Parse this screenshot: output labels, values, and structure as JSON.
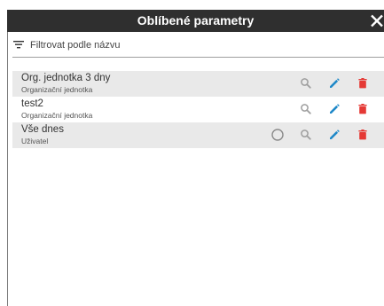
{
  "dialog": {
    "title": "Oblíbené parametry",
    "close_icon": "close-icon"
  },
  "filter": {
    "icon": "filter-list-icon",
    "placeholder": "Filtrovat podle názvu",
    "value": ""
  },
  "items": [
    {
      "title": "Org. jednotka 3 dny",
      "subtitle": "Organizační jednotka",
      "has_radio": false
    },
    {
      "title": "test2",
      "subtitle": "Organizační jednotka",
      "has_radio": false
    },
    {
      "title": "Vše dnes",
      "subtitle": "Uživatel",
      "has_radio": true
    }
  ],
  "colors": {
    "titlebar": "#2f2f2f",
    "row_shaded": "#e9e9e9",
    "search_icon": "#9e9e9e",
    "edit_icon": "#1e88c8",
    "delete_icon": "#e53935"
  }
}
